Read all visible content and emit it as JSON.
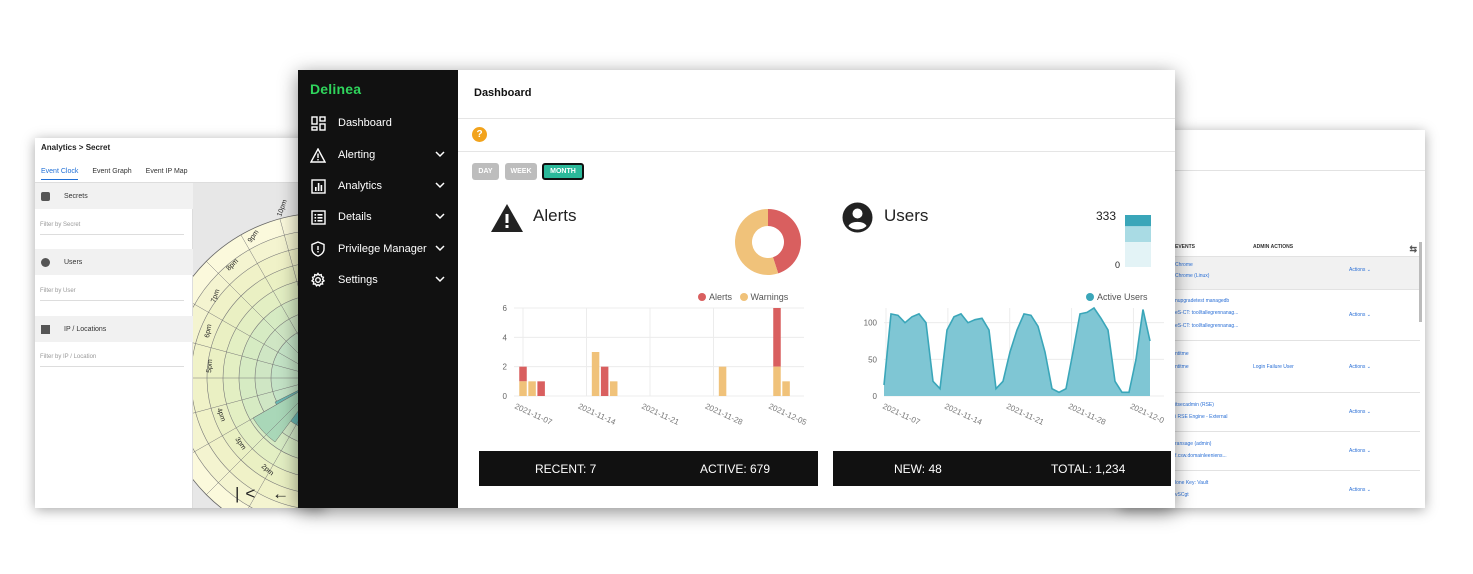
{
  "left_window": {
    "breadcrumb": "Analytics > Secret",
    "tabs": [
      "Event Clock",
      "Event Graph",
      "Event IP Map"
    ],
    "filters": [
      {
        "label": "Secrets",
        "placeholder": "Filter by Secret",
        "icon": "lock-icon"
      },
      {
        "label": "Users",
        "placeholder": "Filter by User",
        "icon": "user-icon"
      },
      {
        "label": "IP / Locations",
        "placeholder": "Filter by IP / Location",
        "icon": "map-icon"
      }
    ],
    "clock_labels": [
      "10pm",
      "9pm",
      "8pm",
      "7pm",
      "6pm",
      "5pm",
      "4pm",
      "3pm",
      "2pm"
    ],
    "nav_glyphs": "|< ←"
  },
  "right_window": {
    "column_headers": [
      "EVENTS",
      "ADMIN ACTIONS"
    ],
    "rows": [
      {
        "lines": [
          "Chrome",
          "Chrome (Linux)"
        ],
        "middle": "",
        "action": "Actions ⌄"
      },
      {
        "lines": [
          "nupgradetest managedb",
          "eS-CT: tool/tallegrennanag...",
          "eS-CT: tool/tallegrennanag..."
        ],
        "middle": "",
        "action": "Actions ⌄"
      },
      {
        "lines": [
          "ntitme",
          "ntitme"
        ],
        "middle": "Login Failure User",
        "action": "Actions ⌄"
      },
      {
        "lines": [
          "itsecadmin (RSE)",
          "i RSE Engine - External"
        ],
        "middle": "",
        "action": "Actions ⌄"
      },
      {
        "lines": [
          "ransage (admin)",
          "f.csw.domainleeniens..."
        ],
        "middle": "",
        "action": "Actions ⌄"
      },
      {
        "lines": [
          "lone Key: Vault",
          "vSCgt"
        ],
        "middle": "",
        "action": "Actions ⌄"
      }
    ]
  },
  "main": {
    "logo": "Delinea",
    "nav": [
      {
        "label": "Dashboard",
        "icon": "dashboard-icon",
        "expandable": false
      },
      {
        "label": "Alerting",
        "icon": "alert-triangle-icon",
        "expandable": true
      },
      {
        "label": "Analytics",
        "icon": "bar-chart-icon",
        "expandable": true
      },
      {
        "label": "Details",
        "icon": "list-icon",
        "expandable": true
      },
      {
        "label": "Privilege Manager",
        "icon": "shield-icon",
        "expandable": true
      },
      {
        "label": "Settings",
        "icon": "gear-icon",
        "expandable": true
      }
    ],
    "page_title": "Dashboard",
    "help_glyph": "?",
    "range_buttons": [
      "DAY",
      "WEEK",
      "MONTH"
    ],
    "active_range": "MONTH",
    "alerts_card": {
      "title": "Alerts",
      "legend": [
        "Alerts",
        "Warnings"
      ],
      "stats": {
        "recent": "RECENT: 7",
        "active": "ACTIVE: 679"
      }
    },
    "users_card": {
      "title": "Users",
      "gauge_max": "333",
      "gauge_min": "0",
      "legend": [
        "Active Users"
      ],
      "stats": {
        "new": "NEW: 48",
        "total": "TOTAL: 1,234"
      }
    }
  },
  "chart_data": [
    {
      "type": "pie",
      "labels": [
        "Alerts",
        "Warnings"
      ],
      "values": [
        45,
        55
      ],
      "colors": [
        "#d95f5f",
        "#f0c27a"
      ],
      "donut": true
    },
    {
      "type": "bar",
      "x_tick_labels": [
        "2021-11-07",
        "2021-11-14",
        "2021-11-21",
        "2021-11-28",
        "2021-12-05"
      ],
      "ylim": [
        0,
        6
      ],
      "yticks": [
        0,
        2,
        4,
        6
      ],
      "grid": true,
      "legend_position": "top-right",
      "series": [
        {
          "name": "Alerts",
          "color": "#d95f5f",
          "points": [
            [
              "2021-11-07",
              1
            ],
            [
              "2021-11-09",
              1
            ],
            [
              "2021-11-16",
              2
            ],
            [
              "2021-12-05",
              4
            ]
          ]
        },
        {
          "name": "Warnings",
          "color": "#f0c27a",
          "points": [
            [
              "2021-11-07",
              1
            ],
            [
              "2021-11-08",
              1
            ],
            [
              "2021-11-15",
              3
            ],
            [
              "2021-11-17",
              1
            ],
            [
              "2021-11-29",
              2
            ],
            [
              "2021-12-05",
              2
            ],
            [
              "2021-12-06",
              1
            ]
          ]
        }
      ]
    },
    {
      "type": "bar",
      "orientation": "stacked-vertical",
      "ylim": [
        0,
        333
      ],
      "yticks": [
        0,
        333
      ],
      "segments": [
        {
          "color": "#3aa6b9",
          "value": 50
        },
        {
          "color": "#a9dbe4",
          "value": 70
        },
        {
          "color": "#e3f3f6",
          "value": 110
        }
      ]
    },
    {
      "type": "area",
      "series_name": "Active Users",
      "color": "#3aa6b9",
      "fill": "#7fc6d4",
      "x_tick_labels": [
        "2021-11-07",
        "2021-11-14",
        "2021-11-21",
        "2021-11-28",
        "2021-12-0"
      ],
      "ylim": [
        0,
        120
      ],
      "yticks": [
        0,
        50,
        100
      ],
      "grid": true,
      "legend_position": "top-right",
      "values": [
        15,
        112,
        110,
        100,
        108,
        112,
        100,
        20,
        10,
        90,
        108,
        112,
        100,
        104,
        106,
        90,
        10,
        20,
        60,
        90,
        112,
        110,
        95,
        60,
        10,
        5,
        10,
        60,
        112,
        114,
        120,
        106,
        90,
        20,
        5,
        5,
        50,
        118,
        75
      ]
    }
  ]
}
